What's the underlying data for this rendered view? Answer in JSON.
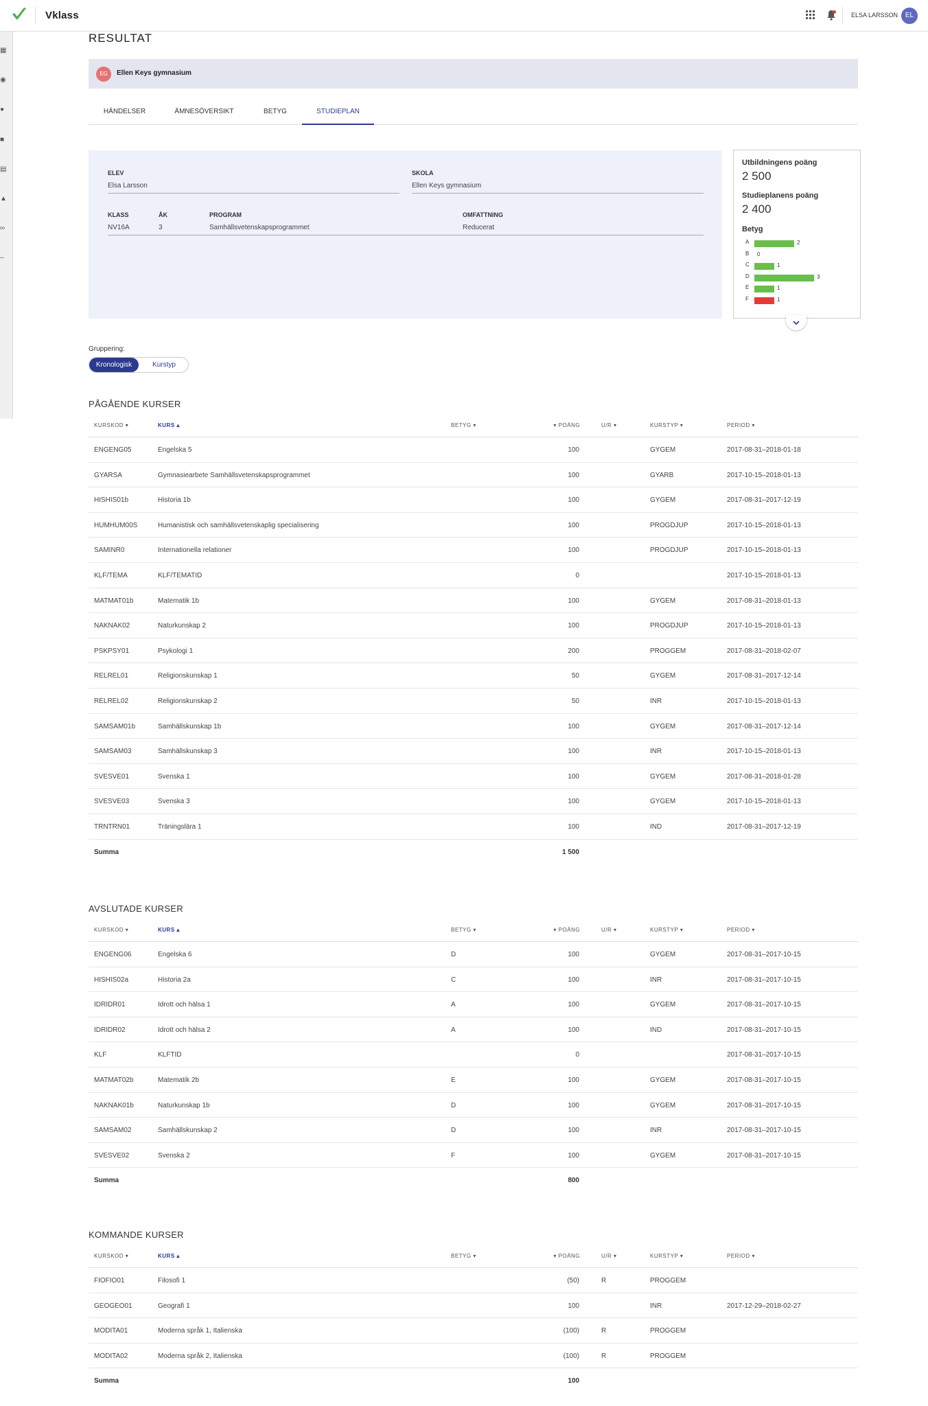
{
  "app": {
    "name": "Vklass",
    "user_name": "ELSA LARSSON",
    "user_initials": "EL"
  },
  "page_title": "RESULTAT",
  "school": {
    "badge": "EG",
    "name": "Ellen Keys gymnasium"
  },
  "tabs": [
    {
      "label": "HÄNDELSER"
    },
    {
      "label": "ÄMNESÖVERSIKT"
    },
    {
      "label": "BETYG"
    },
    {
      "label": "STUDIEPLAN"
    }
  ],
  "info": {
    "elev_label": "ELEV",
    "elev": "Elsa Larsson",
    "skola_label": "SKOLA",
    "skola": "Ellen Keys gymnasium",
    "klass_label": "KLASS",
    "klass": "NV16A",
    "ak_label": "ÅK",
    "ak": "3",
    "program_label": "PROGRAM",
    "program": "Samhällsvetenskapsprogrammet",
    "omfattning_label": "OMFATTNING",
    "omfattning": "Reducerat"
  },
  "stats": {
    "utb_label": "Utbildningens poäng",
    "utb_value": "2 500",
    "plan_label": "Studieplanens poäng",
    "plan_value": "2 400",
    "betyg_label": "Betyg",
    "grades": [
      {
        "letter": "A",
        "count": "2",
        "value": 2,
        "color": "#6abf4b"
      },
      {
        "letter": "B",
        "count": "0",
        "value": 0,
        "color": "#6abf4b"
      },
      {
        "letter": "C",
        "count": "1",
        "value": 1,
        "color": "#6abf4b"
      },
      {
        "letter": "D",
        "count": "3",
        "value": 3,
        "color": "#6abf4b"
      },
      {
        "letter": "E",
        "count": "1",
        "value": 1,
        "color": "#6abf4b"
      },
      {
        "letter": "F",
        "count": "1",
        "value": 1,
        "color": "#e53935"
      }
    ]
  },
  "grouping": {
    "label": "Gruppering:",
    "option_active": "Kronologisk",
    "option_other": "Kurstyp"
  },
  "columns": {
    "kurskod": "KURSKOD",
    "kurs": "KURS",
    "betyg": "BETYG",
    "poang": "POÄNG",
    "ur": "U/R",
    "kurstyp": "KURSTYP",
    "period": "PERIOD"
  },
  "sum_label": "Summa",
  "sections": [
    {
      "title": "PÅGÅENDE KURSER",
      "sum": "1 500",
      "rows": [
        [
          "ENGENG05",
          "Engelska 5",
          "",
          "100",
          "",
          "GYGEM",
          "2017-08-31–2018-01-18"
        ],
        [
          "GYARSA",
          "Gymnasiearbete Samhällsvetenskapsprogrammet",
          "",
          "100",
          "",
          "GYARB",
          "2017-10-15–2018-01-13"
        ],
        [
          "HISHIS01b",
          "Historia 1b",
          "",
          "100",
          "",
          "GYGEM",
          "2017-08-31–2017-12-19"
        ],
        [
          "HUMHUM00S",
          "Humanistisk och samhällsvetenskaplig specialisering",
          "",
          "100",
          "",
          "PROGDJUP",
          "2017-10-15–2018-01-13"
        ],
        [
          "SAMINR0",
          "Internationella relationer",
          "",
          "100",
          "",
          "PROGDJUP",
          "2017-10-15–2018-01-13"
        ],
        [
          "KLF/TEMA",
          "KLF/TEMATID",
          "",
          "0",
          "",
          "",
          "2017-10-15–2018-01-13"
        ],
        [
          "MATMAT01b",
          "Matematik 1b",
          "",
          "100",
          "",
          "GYGEM",
          "2017-08-31–2018-01-13"
        ],
        [
          "NAKNAK02",
          "Naturkunskap 2",
          "",
          "100",
          "",
          "PROGDJUP",
          "2017-10-15–2018-01-13"
        ],
        [
          "PSKPSY01",
          "Psykologi 1",
          "",
          "200",
          "",
          "PROGGEM",
          "2017-08-31–2018-02-07"
        ],
        [
          "RELREL01",
          "Religionskunskap 1",
          "",
          "50",
          "",
          "GYGEM",
          "2017-08-31–2017-12-14"
        ],
        [
          "RELREL02",
          "Religionskunskap 2",
          "",
          "50",
          "",
          "INR",
          "2017-10-15–2018-01-13"
        ],
        [
          "SAMSAM01b",
          "Samhällskunskap 1b",
          "",
          "100",
          "",
          "GYGEM",
          "2017-08-31–2017-12-14"
        ],
        [
          "SAMSAM03",
          "Samhällskunskap 3",
          "",
          "100",
          "",
          "INR",
          "2017-10-15–2018-01-13"
        ],
        [
          "SVESVE01",
          "Svenska 1",
          "",
          "100",
          "",
          "GYGEM",
          "2017-08-31–2018-01-28"
        ],
        [
          "SVESVE03",
          "Svenska 3",
          "",
          "100",
          "",
          "GYGEM",
          "2017-10-15–2018-01-13"
        ],
        [
          "TRNTRN01",
          "Träningslära 1",
          "",
          "100",
          "",
          "IND",
          "2017-08-31–2017-12-19"
        ]
      ]
    },
    {
      "title": "AVSLUTADE KURSER",
      "sum": "800",
      "rows": [
        [
          "ENGENG06",
          "Engelska 6",
          "D",
          "100",
          "",
          "GYGEM",
          "2017-08-31–2017-10-15"
        ],
        [
          "HISHIS02a",
          "Historia 2a",
          "C",
          "100",
          "",
          "INR",
          "2017-08-31–2017-10-15"
        ],
        [
          "IDRIDR01",
          "Idrott och hälsa 1",
          "A",
          "100",
          "",
          "GYGEM",
          "2017-08-31–2017-10-15"
        ],
        [
          "IDRIDR02",
          "Idrott och hälsa 2",
          "A",
          "100",
          "",
          "IND",
          "2017-08-31–2017-10-15"
        ],
        [
          "KLF",
          "KLFTID",
          "",
          "0",
          "",
          "",
          "2017-08-31–2017-10-15"
        ],
        [
          "MATMAT02b",
          "Matematik 2b",
          "E",
          "100",
          "",
          "GYGEM",
          "2017-08-31–2017-10-15"
        ],
        [
          "NAKNAK01b",
          "Naturkunskap 1b",
          "D",
          "100",
          "",
          "GYGEM",
          "2017-08-31–2017-10-15"
        ],
        [
          "SAMSAM02",
          "Samhällskunskap 2",
          "D",
          "100",
          "",
          "INR",
          "2017-08-31–2017-10-15"
        ],
        [
          "SVESVE02",
          "Svenska 2",
          "F",
          "100",
          "",
          "GYGEM",
          "2017-08-31–2017-10-15"
        ]
      ]
    },
    {
      "title": "KOMMANDE KURSER",
      "sum": "100",
      "rows": [
        [
          "FIOFIO01",
          "Filosofi 1",
          "",
          "(50)",
          "R",
          "PROGGEM",
          ""
        ],
        [
          "GEOGEO01",
          "Geografi 1",
          "",
          "100",
          "",
          "INR",
          "2017-12-29–2018-02-27"
        ],
        [
          "MODITA01",
          "Moderna språk 1, Italienska",
          "",
          "(100)",
          "R",
          "PROGGEM",
          ""
        ],
        [
          "MODITA02",
          "Moderna språk 2, Italienska",
          "",
          "(100)",
          "R",
          "PROGGEM",
          ""
        ]
      ]
    }
  ]
}
